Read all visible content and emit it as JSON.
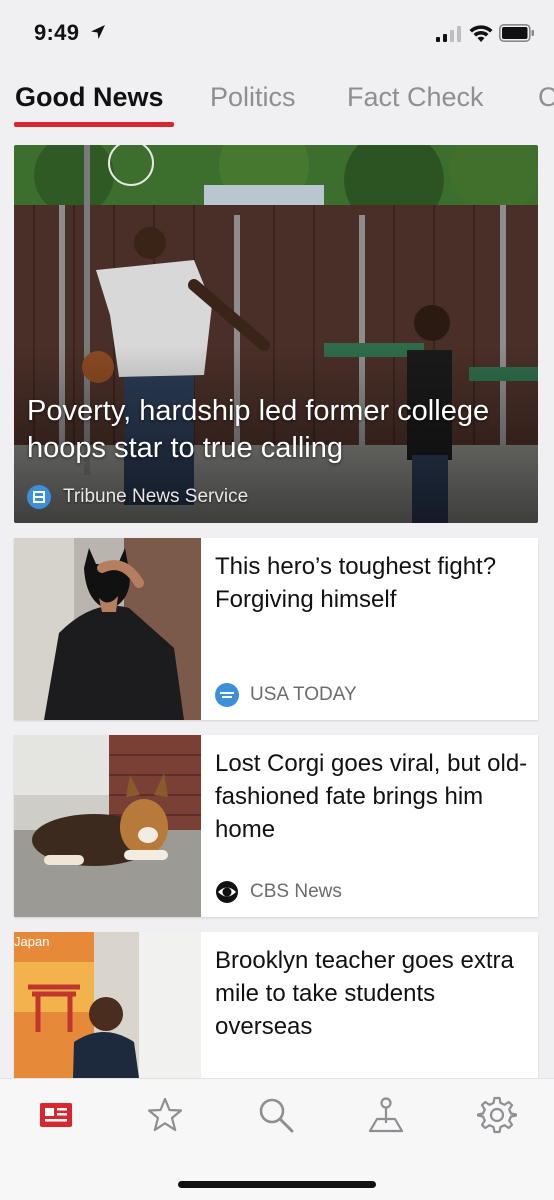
{
  "status_bar": {
    "time": "9:49"
  },
  "tabs": [
    {
      "label": "Good News",
      "active": true
    },
    {
      "label": "Politics",
      "active": false
    },
    {
      "label": "Fact Check",
      "active": false
    },
    {
      "label": "C",
      "active": false
    }
  ],
  "hero": {
    "title": "Poverty, hardship led former college hoops star to true calling",
    "source": "Tribune News Service"
  },
  "articles": [
    {
      "headline": "This hero’s toughest fight? Forgiving himself",
      "source": "USA TODAY"
    },
    {
      "headline": "Lost Corgi goes viral, but old-fashioned fate brings him home",
      "source": "CBS News"
    },
    {
      "headline": "Brooklyn teacher goes extra mile to take students overseas",
      "source": ""
    }
  ],
  "thumb_text": {
    "japan": "Japan"
  },
  "tab_bar": [
    {
      "icon": "news-icon",
      "active": true
    },
    {
      "icon": "star-icon",
      "active": false
    },
    {
      "icon": "search-icon",
      "active": false
    },
    {
      "icon": "local-icon",
      "active": false
    },
    {
      "icon": "gear-icon",
      "active": false
    }
  ],
  "colors": {
    "accent": "#d8262e",
    "inactive_icon": "#8e8e93",
    "background": "#f0f0f2"
  }
}
